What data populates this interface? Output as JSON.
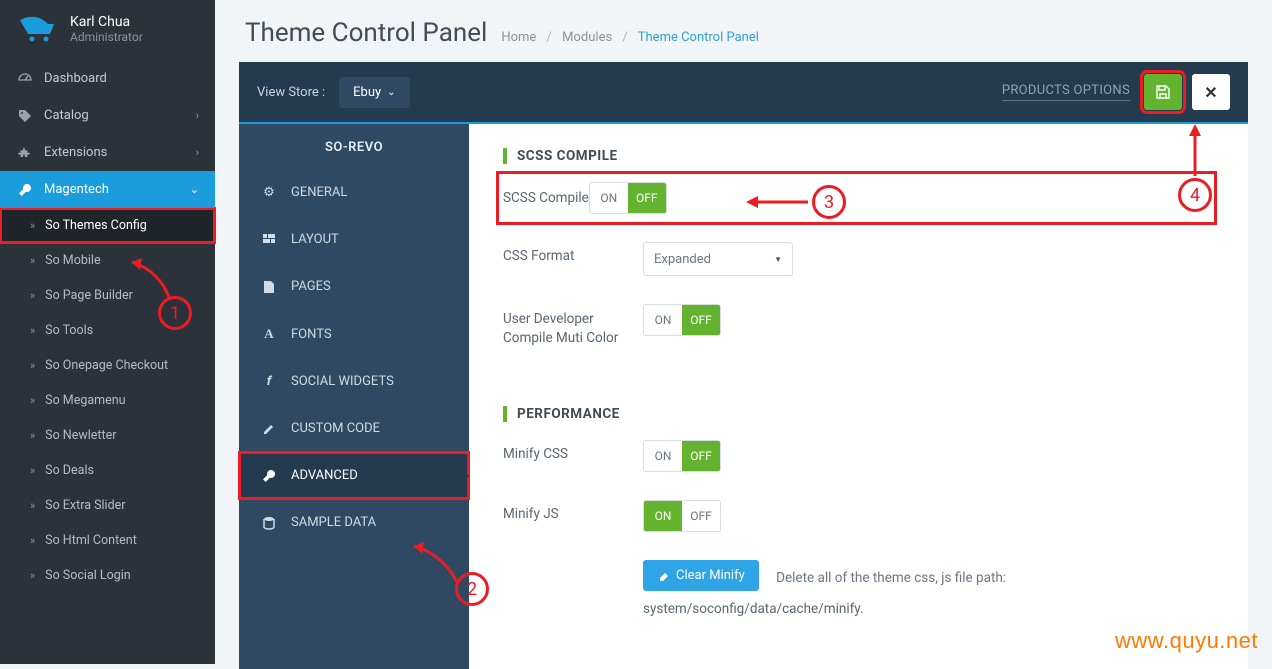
{
  "user": {
    "name": "Karl Chua",
    "role": "Administrator"
  },
  "sidebar": {
    "dashboard": "Dashboard",
    "catalog": "Catalog",
    "extensions": "Extensions",
    "magentech": "Magentech",
    "subs": {
      "so_themes_config": "So Themes Config",
      "so_mobile": "So Mobile",
      "so_page_builder": "So Page Builder",
      "so_tools": "So Tools",
      "so_onepage_checkout": "So Onepage Checkout",
      "so_megamenu": "So Megamenu",
      "so_newletter": "So Newletter",
      "so_deals": "So Deals",
      "so_extra_slider": "So Extra Slider",
      "so_html_content": "So Html Content",
      "so_social_login": "So Social Login"
    }
  },
  "page": {
    "title": "Theme Control Panel",
    "breadcrumb": {
      "home": "Home",
      "modules": "Modules",
      "current": "Theme Control Panel"
    }
  },
  "darkbar": {
    "view_store_label": "View Store :",
    "store_value": "Ebuy",
    "products_options": "PRODUCTS OPTIONS"
  },
  "panel_nav": {
    "title": "SO-REVO",
    "items": {
      "general": "GENERAL",
      "layout": "LAYOUT",
      "pages": "PAGES",
      "fonts": "FONTS",
      "social_widgets": "SOCIAL WIDGETS",
      "custom_code": "CUSTOM CODE",
      "advanced": "ADVANCED",
      "sample_data": "SAMPLE DATA"
    }
  },
  "content": {
    "scss_compile_hdr": "SCSS COMPILE",
    "scss_compile_lbl": "SCSS Compile",
    "on": "ON",
    "off": "OFF",
    "css_format_lbl": "CSS Format",
    "css_format_value": "Expanded",
    "user_dev_lbl": "User Developer Compile Muti Color",
    "performance_hdr": "PERFORMANCE",
    "minify_css_lbl": "Minify CSS",
    "minify_js_lbl": "Minify JS",
    "clear_minify_btn": "Clear Minify",
    "clear_minify_help1": "Delete all of the theme css, js file path:",
    "clear_minify_help2": "system/soconfig/data/cache/minify."
  },
  "annotations": {
    "a1": "1",
    "a2": "2",
    "a3": "3",
    "a4": "4"
  },
  "watermark": "www.quyu.net"
}
